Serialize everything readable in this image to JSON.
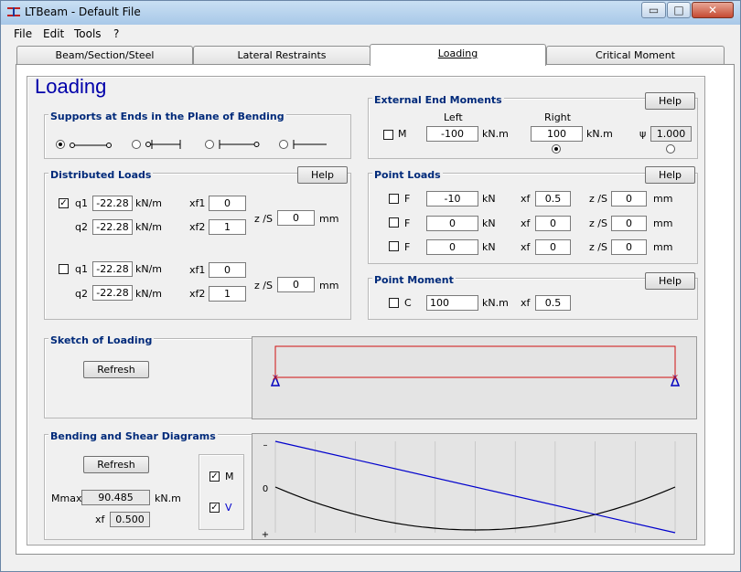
{
  "window": {
    "title": "LTBeam - Default File",
    "min": "▭",
    "max": "□",
    "close": "✕"
  },
  "menu": [
    "File",
    "Edit",
    "Tools",
    "?"
  ],
  "tabs": [
    "Beam/Section/Steel",
    "Lateral Restraints",
    "Loading",
    "Critical Moment"
  ],
  "page_title": "Loading",
  "supports": {
    "title": "Supports at Ends in the Plane of Bending",
    "selected_index": 0
  },
  "end_moments": {
    "title": "External End Moments",
    "help": "Help",
    "left_header": "Left",
    "right_header": "Right",
    "m_label": "M",
    "left_value": "-100",
    "right_value": "100",
    "unit": "kN.m",
    "psi_symbol": "ψ",
    "psi_value": "1.000",
    "checked": false
  },
  "distributed": {
    "title": "Distributed Loads",
    "help": "Help",
    "set1": {
      "checked": true,
      "q1_label": "q1",
      "q1": "-22.28",
      "q2_label": "q2",
      "q2": "-22.28",
      "unit": "kN/m",
      "xf1_label": "xf1",
      "xf1": "0",
      "xf2_label": "xf2",
      "xf2": "1",
      "zs_label": "z /S",
      "zs": "0",
      "zs_unit": "mm"
    },
    "set2": {
      "checked": false,
      "q1_label": "q1",
      "q1": "-22.28",
      "q2_label": "q2",
      "q2": "-22.28",
      "unit": "kN/m",
      "xf1_label": "xf1",
      "xf1": "0",
      "xf2_label": "xf2",
      "xf2": "1",
      "zs_label": "z /S",
      "zs": "0",
      "zs_unit": "mm"
    }
  },
  "point_loads": {
    "title": "Point Loads",
    "help": "Help",
    "rows": [
      {
        "f_label": "F",
        "f": "-10",
        "unit": "kN",
        "xf_label": "xf",
        "xf": "0.5",
        "zs_label": "z /S",
        "zs": "0",
        "zs_unit": "mm"
      },
      {
        "f_label": "F",
        "f": "0",
        "unit": "kN",
        "xf_label": "xf",
        "xf": "0",
        "zs_label": "z /S",
        "zs": "0",
        "zs_unit": "mm"
      },
      {
        "f_label": "F",
        "f": "0",
        "unit": "kN",
        "xf_label": "xf",
        "xf": "0",
        "zs_label": "z /S",
        "zs": "0",
        "zs_unit": "mm"
      }
    ]
  },
  "point_moment": {
    "title": "Point Moment",
    "help": "Help",
    "c_label": "C",
    "c": "100",
    "unit": "kN.m",
    "xf_label": "xf",
    "xf": "0.5"
  },
  "sketch": {
    "title": "Sketch of Loading",
    "refresh": "Refresh"
  },
  "diagrams": {
    "title": "Bending and Shear Diagrams",
    "refresh": "Refresh",
    "mmax_label": "Mmax",
    "mmax": "90.485",
    "mmax_unit": "kN.m",
    "xf_label": "xf",
    "xf": "0.500",
    "m_check": "M",
    "v_check": "V",
    "axis_minus": "–",
    "axis_zero": "0",
    "axis_plus": "+",
    "colors": {
      "moment": "#000000",
      "shear": "#0000cc"
    }
  }
}
